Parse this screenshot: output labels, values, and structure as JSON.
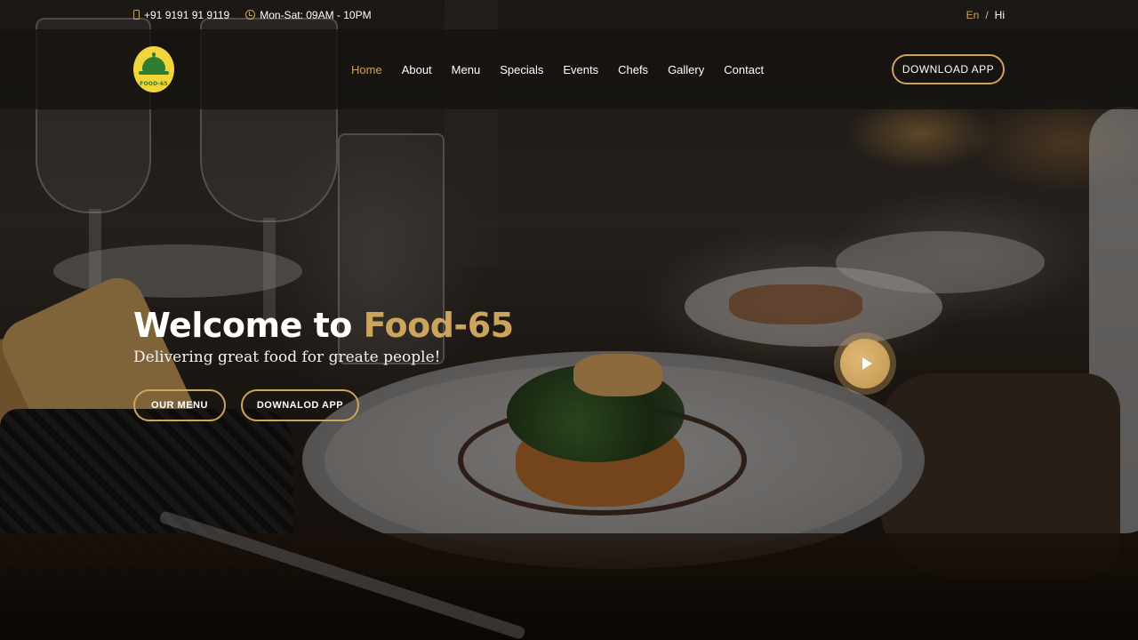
{
  "topbar": {
    "phone": "+91 9191 91 9119",
    "hours": "Mon-Sat: 09AM - 10PM",
    "lang_en": "En",
    "lang_sep": "/",
    "lang_hi": "Hi"
  },
  "header": {
    "logo_text": "FOOD-65",
    "nav": {
      "home": "Home",
      "about": "About",
      "menu": "Menu",
      "specials": "Specials",
      "events": "Events",
      "chefs": "Chefs",
      "gallery": "Gallery",
      "contact": "Contact"
    },
    "download_app": "DOWNLOAD APP"
  },
  "hero": {
    "title_prefix": "Welcome to ",
    "title_brand": "Food-65",
    "subtitle": "Delivering great food for greate people!",
    "btn_menu": "OUR MENU",
    "btn_download": "DOWNALOD APP"
  },
  "colors": {
    "accent": "#cda45e",
    "logo_yellow": "#f0d53b",
    "logo_green": "#2e7d32"
  },
  "icons": {
    "phone": "phone-icon",
    "clock": "clock-icon",
    "play": "play-icon"
  }
}
